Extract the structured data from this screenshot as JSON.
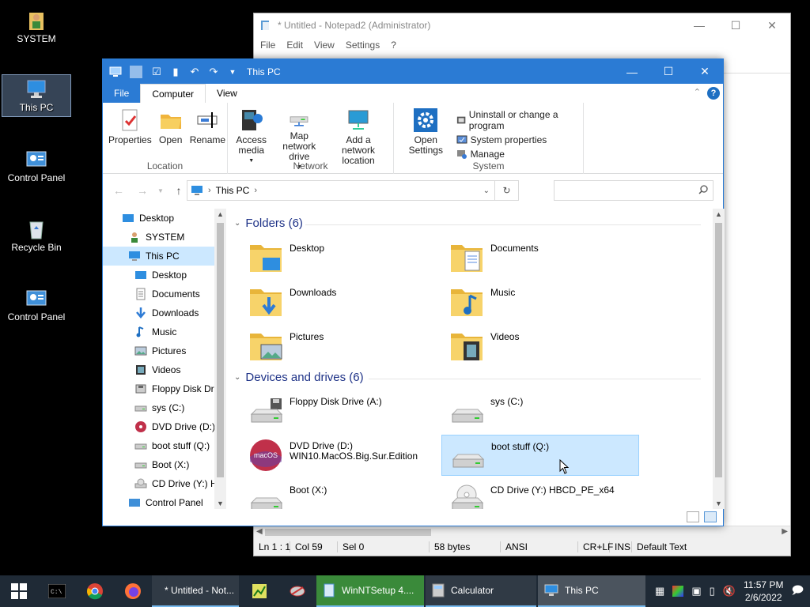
{
  "desktop": {
    "icons": [
      {
        "label": "SYSTEM"
      },
      {
        "label": "This PC"
      },
      {
        "label": "Control Panel"
      },
      {
        "label": "Recycle Bin"
      },
      {
        "label": "Control Panel"
      }
    ]
  },
  "notepad": {
    "title": "* Untitled - Notepad2 (Administrator)",
    "menu": [
      "File",
      "Edit",
      "View",
      "Settings",
      "?"
    ],
    "status": {
      "position": "Ln 1 : 1",
      "column": "Col 59",
      "selection": "Sel 0",
      "size": "58 bytes",
      "encoding": "ANSI",
      "line_endings": "CR+LF",
      "insert_mode": "INS",
      "scheme": "Default Text"
    }
  },
  "explorer": {
    "title": "This PC",
    "tabs": {
      "file": "File",
      "computer": "Computer",
      "view": "View"
    },
    "ribbon": {
      "location": {
        "label": "Location",
        "properties": "Properties",
        "open": "Open",
        "rename": "Rename"
      },
      "network": {
        "label": "Network",
        "access_media": "Access media",
        "map_drive": "Map network drive",
        "add_location": "Add a network location"
      },
      "system": {
        "label": "System",
        "open_settings": "Open Settings",
        "uninstall": "Uninstall or change a program",
        "system_properties": "System properties",
        "manage": "Manage"
      }
    },
    "address": {
      "path": "This PC",
      "search_placeholder": ""
    },
    "nav_pane": [
      {
        "label": "Desktop",
        "level": 0
      },
      {
        "label": "SYSTEM",
        "level": 1
      },
      {
        "label": "This PC",
        "level": 1,
        "selected": true
      },
      {
        "label": "Desktop",
        "level": 2
      },
      {
        "label": "Documents",
        "level": 2
      },
      {
        "label": "Downloads",
        "level": 2
      },
      {
        "label": "Music",
        "level": 2
      },
      {
        "label": "Pictures",
        "level": 2
      },
      {
        "label": "Videos",
        "level": 2
      },
      {
        "label": "Floppy Disk Dri",
        "level": 2
      },
      {
        "label": "sys (C:)",
        "level": 2
      },
      {
        "label": "DVD Drive (D:)",
        "level": 2
      },
      {
        "label": "boot stuff (Q:)",
        "level": 2
      },
      {
        "label": "Boot (X:)",
        "level": 2
      },
      {
        "label": "CD Drive (Y:) H",
        "level": 2
      },
      {
        "label": "Control Panel",
        "level": 1
      }
    ],
    "folders_header": "Folders (6)",
    "folders": [
      {
        "name": "Desktop"
      },
      {
        "name": "Documents"
      },
      {
        "name": "Downloads"
      },
      {
        "name": "Music"
      },
      {
        "name": "Pictures"
      },
      {
        "name": "Videos"
      }
    ],
    "drives_header": "Devices and drives (6)",
    "drives": [
      {
        "name": "Floppy Disk Drive (A:)",
        "sub": ""
      },
      {
        "name": "sys (C:)",
        "sub": ""
      },
      {
        "name": "DVD Drive (D:)",
        "sub": "WIN10.MacOS.Big.Sur.Edition",
        "disc_label": "macOS"
      },
      {
        "name": "boot stuff (Q:)",
        "sub": "",
        "selected": true
      },
      {
        "name": "Boot (X:)",
        "sub": ""
      },
      {
        "name": "CD Drive (Y:) HBCD_PE_x64",
        "sub": ""
      }
    ]
  },
  "taskbar": {
    "apps": [
      {
        "label": "* Untitled - Not..."
      },
      {
        "label": "WinNTSetup 4...."
      },
      {
        "label": "Calculator"
      },
      {
        "label": "This PC"
      }
    ],
    "clock": {
      "time": "11:57 PM",
      "date": "2/6/2022"
    }
  },
  "colors": {
    "accent": "#2b7bd4",
    "selection": "#cce8ff",
    "taskbar": "#1f2a36",
    "group_header": "#1e3287"
  }
}
